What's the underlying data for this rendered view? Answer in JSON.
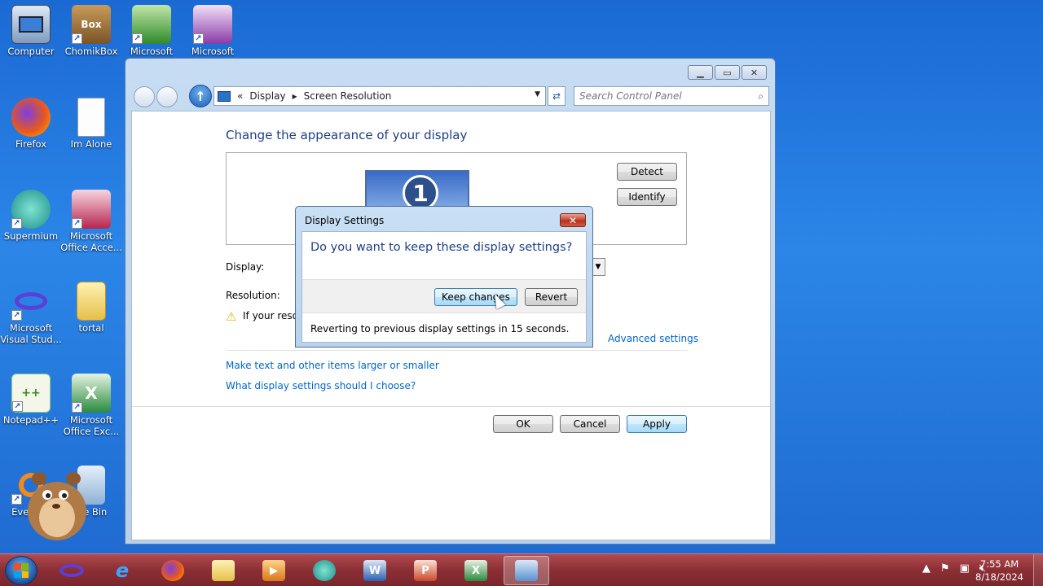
{
  "desktop": {
    "icons": [
      {
        "label": "Computer"
      },
      {
        "label": "ChomikBox",
        "glyph": "Box"
      },
      {
        "label": "Microsoft"
      },
      {
        "label": "Microsoft"
      },
      {
        "label": "Firefox"
      },
      {
        "label": "Im Alone"
      },
      {
        "label": "Supermium"
      },
      {
        "label": "Microsoft Office Acce..."
      },
      {
        "label": "Microsoft Visual Stud..."
      },
      {
        "label": "tortal"
      },
      {
        "label": "Notepad++"
      },
      {
        "label": "Microsoft Office Exc..."
      },
      {
        "label": "Everythi"
      },
      {
        "label": "cle Bin"
      }
    ]
  },
  "window": {
    "breadcrumb": {
      "sep": "«",
      "display": "Display",
      "arrow": "▸",
      "current": "Screen Resolution"
    },
    "search_placeholder": "Search Control Panel",
    "heading": "Change the appearance of your display",
    "monitor_number": "1",
    "detect": "Detect",
    "identify": "Identify",
    "display_label": "Display:",
    "resolution_label": "Resolution:",
    "warning_text": "If your resol",
    "advanced_settings": "Advanced settings",
    "link_larger": "Make text and other items larger or smaller",
    "link_choose": "What display settings should I choose?",
    "ok": "OK",
    "cancel": "Cancel",
    "apply": "Apply"
  },
  "dialog": {
    "title": "Display Settings",
    "question": "Do you want to keep these display settings?",
    "keep": "Keep changes",
    "revert": "Revert",
    "countdown": "Reverting to previous display settings in 15 seconds."
  },
  "taskbar": {
    "time": "7:55 AM",
    "date": "8/18/2024"
  },
  "colors": {
    "taskbar": "#8b2f35",
    "heading": "#1e3f88",
    "link": "#0066cc"
  }
}
